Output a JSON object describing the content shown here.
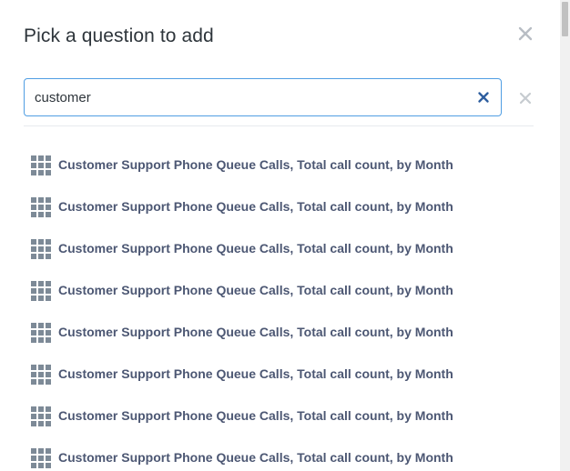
{
  "modal": {
    "title": "Pick a question to add",
    "close_icon": "close-icon"
  },
  "search": {
    "value": "customer",
    "placeholder": "",
    "clear_icon": "close-icon",
    "focus_color": "#509ee3"
  },
  "secondary_close_icon": "close-icon",
  "results": [
    {
      "label": "Customer Support Phone Queue Calls, Total call count, by Month",
      "icon": "table-grid-icon"
    },
    {
      "label": "Customer Support Phone Queue Calls, Total call count, by Month",
      "icon": "table-grid-icon"
    },
    {
      "label": "Customer Support Phone Queue Calls, Total call count, by Month",
      "icon": "table-grid-icon"
    },
    {
      "label": "Customer Support Phone Queue Calls, Total call count, by Month",
      "icon": "table-grid-icon"
    },
    {
      "label": "Customer Support Phone Queue Calls, Total call count, by Month",
      "icon": "table-grid-icon"
    },
    {
      "label": "Customer Support Phone Queue Calls, Total call count, by Month",
      "icon": "table-grid-icon"
    },
    {
      "label": "Customer Support Phone Queue Calls, Total call count, by Month",
      "icon": "table-grid-icon"
    },
    {
      "label": "Customer Support Phone Queue Calls, Total call count, by Month",
      "icon": "table-grid-icon"
    }
  ],
  "colors": {
    "title": "#2e353b",
    "result_text": "#4c5773",
    "icon_gray": "#7d8a97",
    "clear_icon_blue": "#2e5e9f",
    "close_gray": "#b8bdc4",
    "divider": "#e7ebee"
  }
}
